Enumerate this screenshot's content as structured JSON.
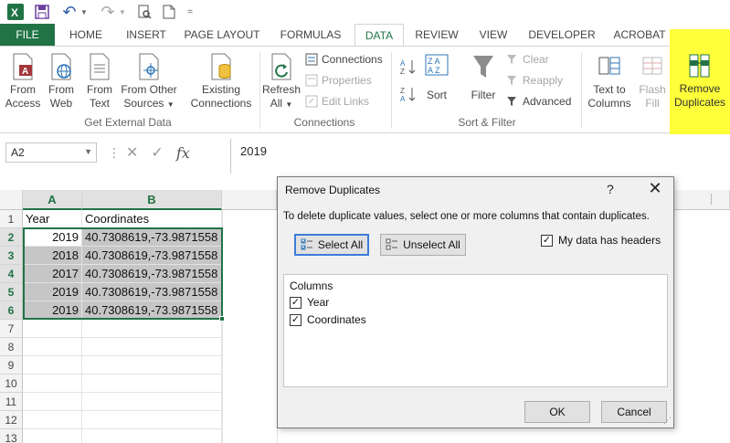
{
  "qat": {
    "undo_label": "↶",
    "redo_label": "↷"
  },
  "tabs": [
    {
      "label": "FILE"
    },
    {
      "label": "HOME"
    },
    {
      "label": "INSERT"
    },
    {
      "label": "PAGE LAYOUT"
    },
    {
      "label": "FORMULAS"
    },
    {
      "label": "DATA"
    },
    {
      "label": "REVIEW"
    },
    {
      "label": "VIEW"
    },
    {
      "label": "DEVELOPER"
    },
    {
      "label": "ACROBAT"
    }
  ],
  "ribbon": {
    "get_external": {
      "group": "Get External Data",
      "from_access": [
        "From",
        "Access"
      ],
      "from_web": [
        "From",
        "Web"
      ],
      "from_text": [
        "From",
        "Text"
      ],
      "from_other": [
        "From Other",
        "Sources"
      ],
      "existing": [
        "Existing",
        "Connections"
      ]
    },
    "connections": {
      "group": "Connections",
      "refresh": [
        "Refresh",
        "All"
      ],
      "connections": "Connections",
      "properties": "Properties",
      "edit_links": "Edit Links"
    },
    "sort_filter": {
      "group": "Sort & Filter",
      "sort": "Sort",
      "filter": "Filter",
      "clear": "Clear",
      "reapply": "Reapply",
      "advanced": "Advanced"
    },
    "data_tools": {
      "text_to_columns": [
        "Text to",
        "Columns"
      ],
      "flash_fill": [
        "Flash",
        "Fill"
      ],
      "remove_duplicates": [
        "Remove",
        "Duplicates"
      ]
    },
    "highlight_color": "#ffff3a",
    "accent": "#217346"
  },
  "formula_bar": {
    "name_box": "A2",
    "value": "2019",
    "fx": "fx"
  },
  "sheet": {
    "columns": [
      "A",
      "B"
    ],
    "rows": [
      {
        "n": "1",
        "a": "Year",
        "b": "Coordinates"
      },
      {
        "n": "2",
        "a": "2019",
        "b": "40.7308619,-73.9871558"
      },
      {
        "n": "3",
        "a": "2018",
        "b": "40.7308619,-73.9871558"
      },
      {
        "n": "4",
        "a": "2017",
        "b": "40.7308619,-73.9871558"
      },
      {
        "n": "5",
        "a": "2019",
        "b": "40.7308619,-73.9871558"
      },
      {
        "n": "6",
        "a": "2019",
        "b": "40.7308619,-73.9871558"
      },
      {
        "n": "7",
        "a": "",
        "b": ""
      },
      {
        "n": "8",
        "a": "",
        "b": ""
      },
      {
        "n": "9",
        "a": "",
        "b": ""
      },
      {
        "n": "10",
        "a": "",
        "b": ""
      },
      {
        "n": "11",
        "a": "",
        "b": ""
      },
      {
        "n": "12",
        "a": "",
        "b": ""
      },
      {
        "n": "13",
        "a": "",
        "b": ""
      }
    ]
  },
  "dialog": {
    "title": "Remove Duplicates",
    "help": "?",
    "close": "✕",
    "instruction": "To delete duplicate values, select one or more columns that contain duplicates.",
    "select_all": "Select All",
    "unselect_all": "Unselect All",
    "my_data_has_headers": "My data has headers",
    "columns_label": "Columns",
    "column_items": [
      "Year",
      "Coordinates"
    ],
    "ok": "OK",
    "cancel": "Cancel"
  }
}
